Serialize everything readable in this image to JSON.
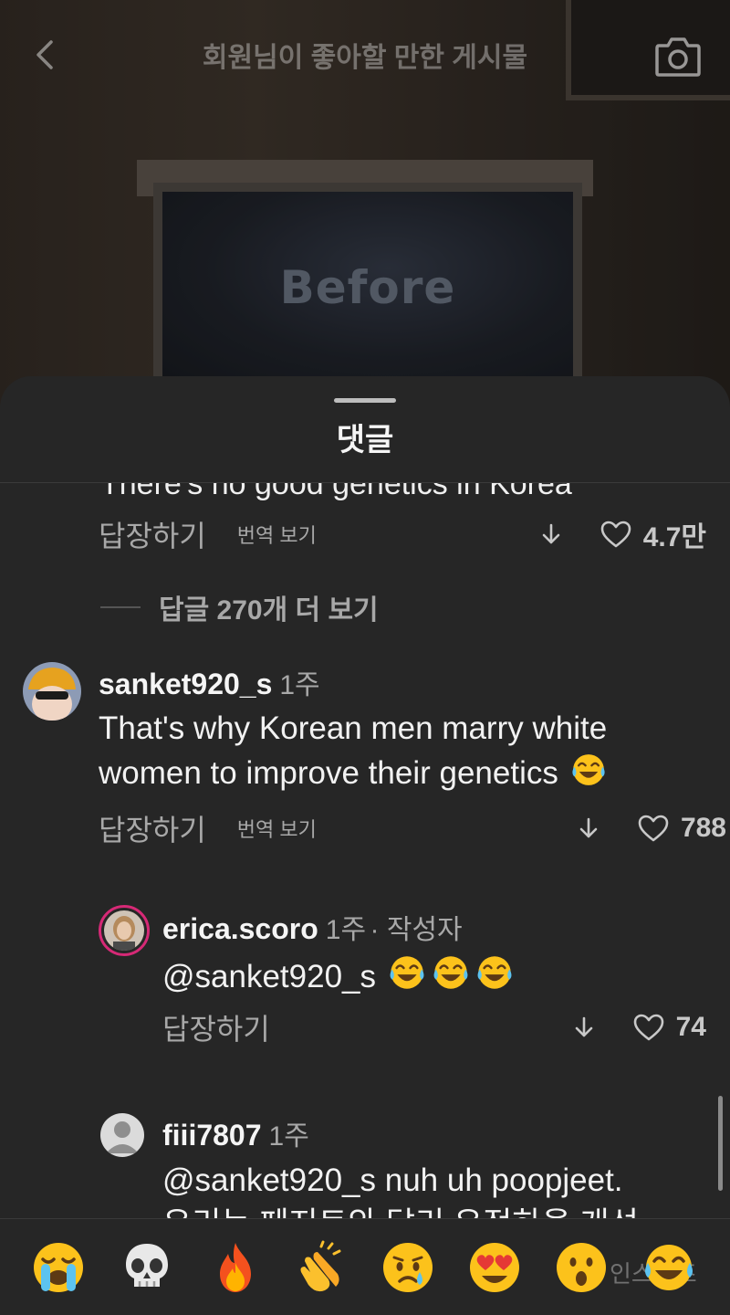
{
  "header": {
    "title": "회원님이 좋아할 만한 게시물",
    "background_text": "Before"
  },
  "sheet": {
    "title": "댓글"
  },
  "thread_top": {
    "cut_text": "There's no good genetics in Korea",
    "reply_label": "답장하기",
    "translate_label": "번역 보기",
    "like_count": "4.7만"
  },
  "more_replies": {
    "label": "답글 270개 더 보기"
  },
  "comments": [
    {
      "username": "sanket920_s",
      "time": "1주",
      "text_line1": "That's why Korean men marry white",
      "text_line2": "women to improve their genetics",
      "reply_label": "답장하기",
      "translate_label": "번역 보기",
      "like_count": "788"
    },
    {
      "username": "erica.scoro",
      "time": "1주",
      "author_tag": "· 작성자",
      "mention": "@sanket920_s",
      "reply_label": "답장하기",
      "like_count": "74"
    },
    {
      "username": "fiii7807",
      "time": "1주",
      "text_line1": "@sanket920_s nuh uh poopjeet.",
      "text_line2": "우리는 페지트와 달리 우전하을 개선"
    }
  ],
  "emoji_bar": {
    "emojis": [
      "loudly-crying-face",
      "skull",
      "fire",
      "clapping-hands",
      "crying-face",
      "heart-eyes-face",
      "astonished-face",
      "tears-of-joy-face"
    ],
    "watermark": "인스티즈"
  },
  "colors": {
    "sheet_background": "#262626",
    "secondary_text": "#a8a8a8",
    "primary_text": "#f5f5f5",
    "emoji_yellow": "#fcc21b"
  }
}
